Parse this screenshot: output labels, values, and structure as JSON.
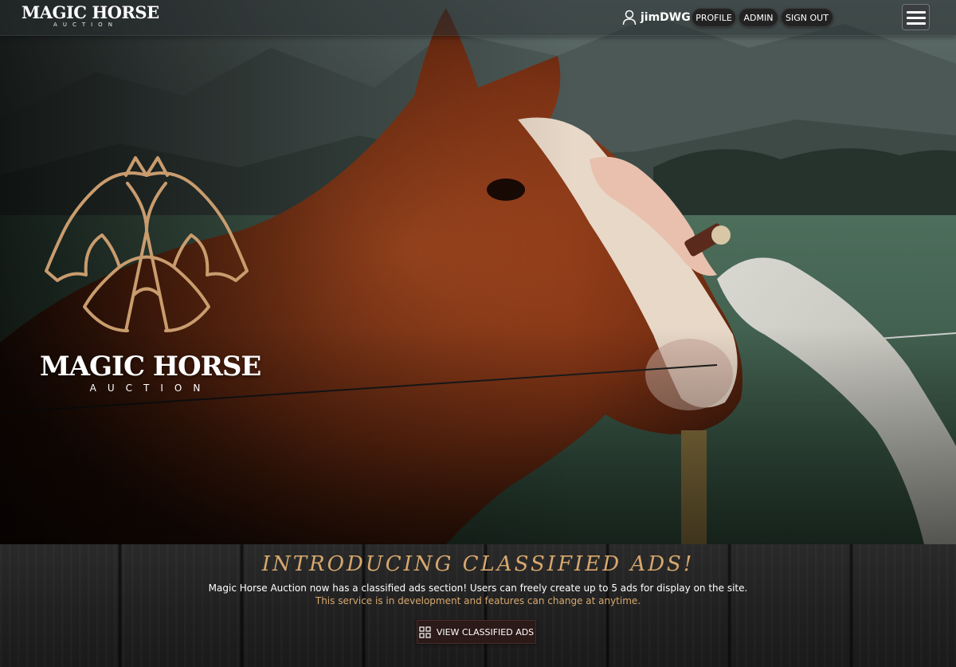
{
  "header": {
    "brand_main": "MAGIC HORSE",
    "brand_sub": "AUCTION",
    "username": "jimDWG",
    "nav": {
      "profile": "PROFILE",
      "admin": "ADMIN",
      "sign_out": "SIGN OUT"
    }
  },
  "hero": {
    "logo_title": "MAGIC HORSE",
    "logo_sub": "AUCTION"
  },
  "announcement": {
    "headline": "INTRODUCING CLASSIFIED ADS!",
    "line1": "Magic Horse Auction now has a classified ads section! Users can freely create up to 5 ads for display on the site.",
    "line2": "This service is in development and features can change at anytime.",
    "cta_label": "VIEW CLASSIFIED ADS"
  },
  "colors": {
    "accent_gold": "#d7a86e",
    "button_dark": "#222222",
    "cta_bg": "#2c1a18"
  }
}
